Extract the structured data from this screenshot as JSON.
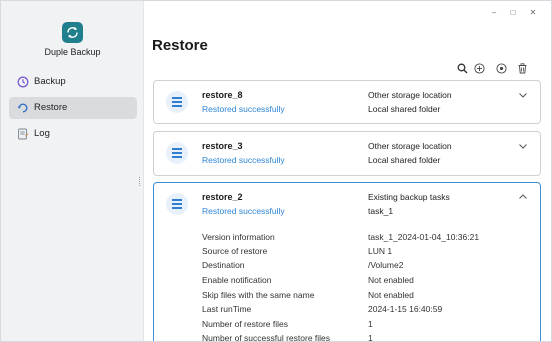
{
  "app": {
    "name": "Duple Backup"
  },
  "window_controls": {
    "minimize": "–",
    "maximize": "□",
    "close": "✕"
  },
  "sidebar": {
    "items": [
      {
        "label": "Backup",
        "icon": "backup-clock-icon",
        "active": false
      },
      {
        "label": "Restore",
        "icon": "restore-icon",
        "active": true
      },
      {
        "label": "Log",
        "icon": "log-icon",
        "active": false
      }
    ]
  },
  "page": {
    "title": "Restore"
  },
  "toolbar": {
    "icons": [
      "search-icon",
      "add-icon",
      "restore-circle-icon",
      "delete-icon"
    ]
  },
  "jobs": [
    {
      "name": "restore_8",
      "status": "Restored successfully",
      "dest_type": "Other storage location",
      "dest_name": "Local shared folder",
      "expanded": false
    },
    {
      "name": "restore_3",
      "status": "Restored successfully",
      "dest_type": "Other storage location",
      "dest_name": "Local shared folder",
      "expanded": false
    },
    {
      "name": "restore_2",
      "status": "Restored successfully",
      "dest_type": "Existing backup tasks",
      "dest_name": "task_1",
      "expanded": true,
      "details": [
        {
          "key": "Version information",
          "value": "task_1_2024-01-04_10:36:21"
        },
        {
          "key": "Source of restore",
          "value": "LUN 1"
        },
        {
          "key": "Destination",
          "value": "/Volume2"
        },
        {
          "key": "Enable notification",
          "value": "Not enabled"
        },
        {
          "key": "Skip files with the same name",
          "value": "Not enabled"
        },
        {
          "key": "Last runTime",
          "value": "2024-1-15 16:40:59"
        },
        {
          "key": "Number of restore files",
          "value": "1"
        },
        {
          "key": "Number of successful restore files",
          "value": "1"
        }
      ]
    }
  ],
  "colors": {
    "accent": "#2f86d6",
    "logo": "#1f7f8c",
    "sidebar_bg": "#f1f2f4",
    "active_item_bg": "#d9dbdf"
  }
}
